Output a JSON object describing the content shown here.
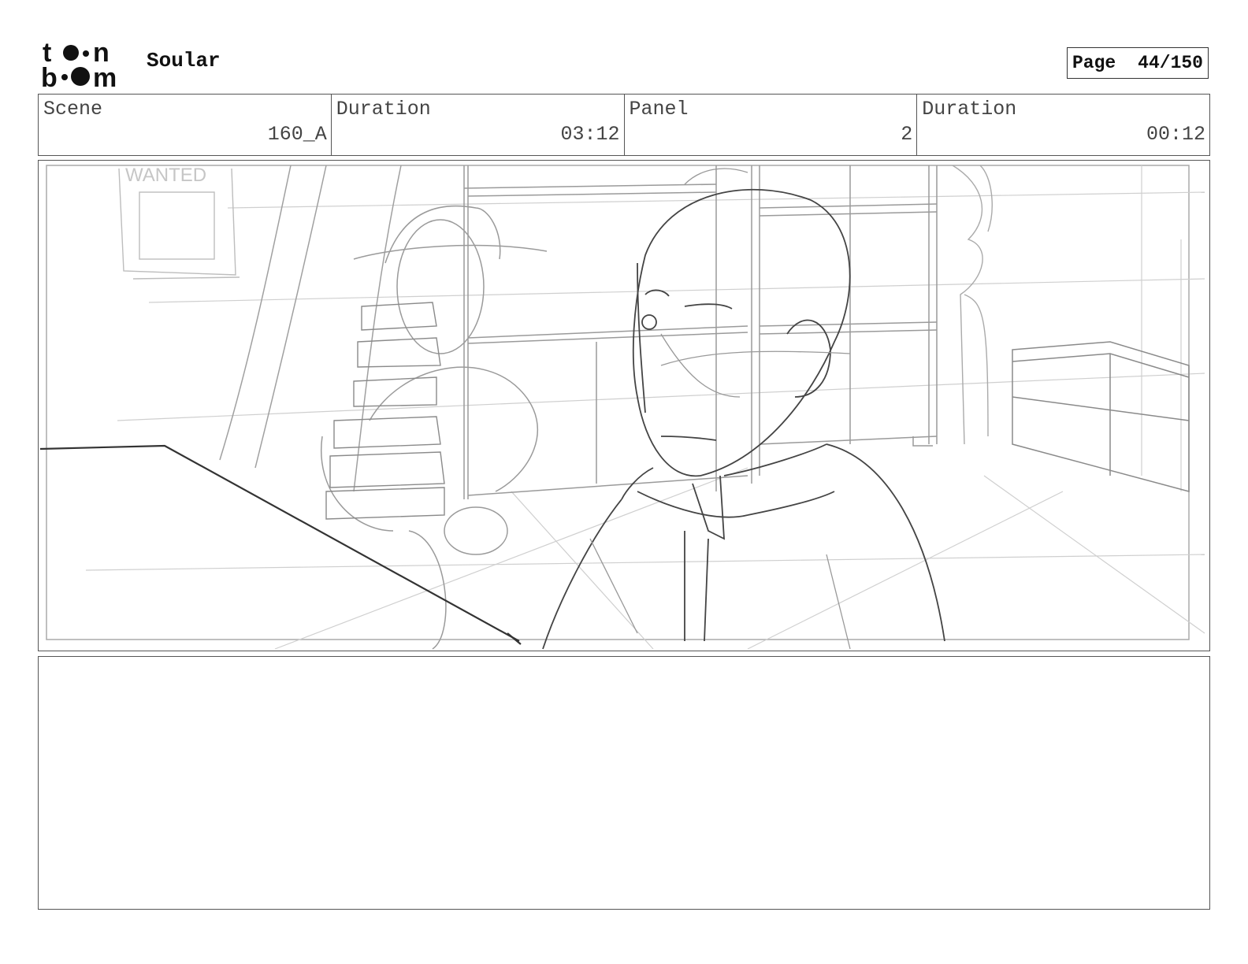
{
  "header": {
    "logo_top": "t●●n",
    "logo_bottom": "b●●m",
    "project_title": "Soular",
    "page_label": "Page",
    "page_value": "44/150"
  },
  "info": {
    "scene_label": "Scene",
    "scene_value": "160_A",
    "scene_duration_label": "Duration",
    "scene_duration_value": "03:12",
    "panel_label": "Panel",
    "panel_value": "2",
    "panel_duration_label": "Duration",
    "panel_duration_value": "00:12"
  },
  "panel": {
    "sketch_sign_text": "WANTED"
  },
  "notes": {}
}
